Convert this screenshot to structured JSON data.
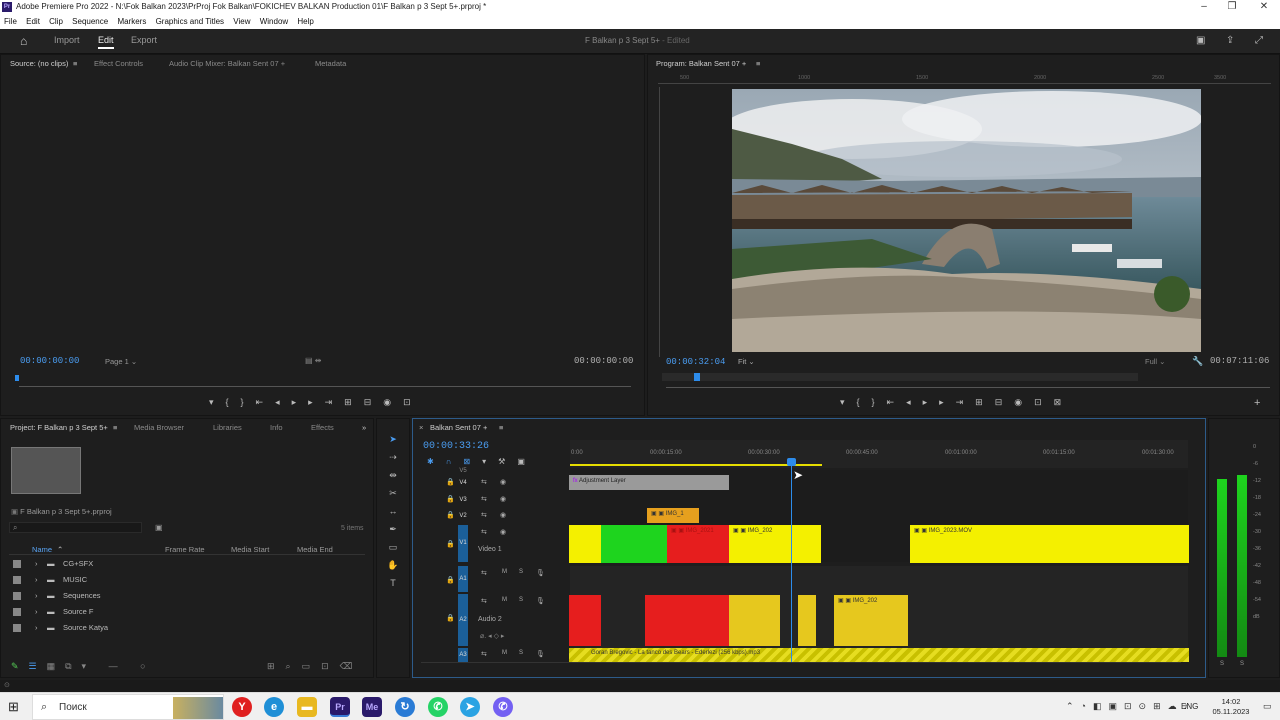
{
  "window": {
    "title": "Adobe Premiere Pro 2022 - N:\\Fok Balkan 2023\\PrProj Fok Balkan\\FOKICHEV BALKAN Production 01\\F Balkan p 3 Sept 5+.prproj *",
    "app_icon": "Pr"
  },
  "menu": [
    "File",
    "Edit",
    "Clip",
    "Sequence",
    "Markers",
    "Graphics and Titles",
    "View",
    "Window",
    "Help"
  ],
  "workspace": {
    "tabs": [
      "Import",
      "Edit",
      "Export"
    ],
    "active": "Edit",
    "project_title": "F Balkan p 3 Sept 5+",
    "status": "- Edited"
  },
  "source": {
    "tabs": [
      "Source: (no clips)",
      "Effect Controls",
      "Audio Clip Mixer: Balkan  Sent  07 +",
      "Metadata"
    ],
    "timecode_left": "00:00:00:00",
    "page": "Page 1",
    "timecode_right": "00:00:00:00"
  },
  "program": {
    "tab": "Program: Balkan  Sent  07 +",
    "timecode": "00:00:32:04",
    "fit": "Fit",
    "quality": "Full",
    "duration": "00:07:11:06",
    "ruler": [
      "500",
      "1000",
      "1500",
      "2000",
      "2500",
      "3000",
      "3500"
    ]
  },
  "project": {
    "tabs": [
      "Project: F Balkan p 3 Sept 5+",
      "Media Browser",
      "Libraries",
      "Info",
      "Effects"
    ],
    "file": "F Balkan p 3 Sept 5+.prproj",
    "items_count": "5 items",
    "columns": [
      "Name",
      "Frame Rate",
      "Media Start",
      "Media End"
    ],
    "bins": [
      "CG+SFX",
      "MUSIC",
      "Sequences",
      "Source  F",
      "Source Katya"
    ]
  },
  "timeline": {
    "tab": "Balkan  Sent  07 +",
    "timecode": "00:00:33:26",
    "ruler": [
      "0:00",
      "00:00:15:00",
      "00:00:30:00",
      "00:00:45:00",
      "00:01:00:00",
      "00:01:15:00",
      "00:01:30:00"
    ],
    "video_tracks": [
      {
        "name": "V5",
        "label": ""
      },
      {
        "name": "V4",
        "label": ""
      },
      {
        "name": "V3",
        "label": ""
      },
      {
        "name": "V2",
        "label": ""
      },
      {
        "name": "V1",
        "label": "Video 1"
      }
    ],
    "audio_tracks": [
      {
        "name": "A1",
        "label": "",
        "m": "M",
        "s": "S"
      },
      {
        "name": "A2",
        "label": "Audio 2",
        "m": "M",
        "s": "S"
      },
      {
        "name": "A3",
        "label": "",
        "m": "M",
        "s": "S"
      }
    ],
    "clips": {
      "adjustment": "Adjustment Layer",
      "v2": "IMG_1",
      "v1_red": "IMG_2021",
      "v1_yellow": "IMG_202",
      "v1_last": "IMG_2023.MOV",
      "a2_last": "IMG_202",
      "music": "Goran Bregovic - La tanco des Bears - Ederlezi (256  kbps).mp3"
    }
  },
  "meter": {
    "scale": [
      "0",
      "-6",
      "-12",
      "-18",
      "-24",
      "-30",
      "-36",
      "-42",
      "-48",
      "-54",
      "dB"
    ],
    "solo": [
      "S",
      "S"
    ]
  },
  "taskbar": {
    "search": "Поиск",
    "lang": "ENG",
    "time": "14:02",
    "date": "05.11.2023"
  },
  "colors": {
    "accent": "#2d8ceb",
    "clip_yellow": "#f4f000",
    "clip_green": "#1ed41e",
    "clip_red": "#e61e1e",
    "clip_orange": "#e6a01e",
    "track_blue": "#1b5f99"
  }
}
